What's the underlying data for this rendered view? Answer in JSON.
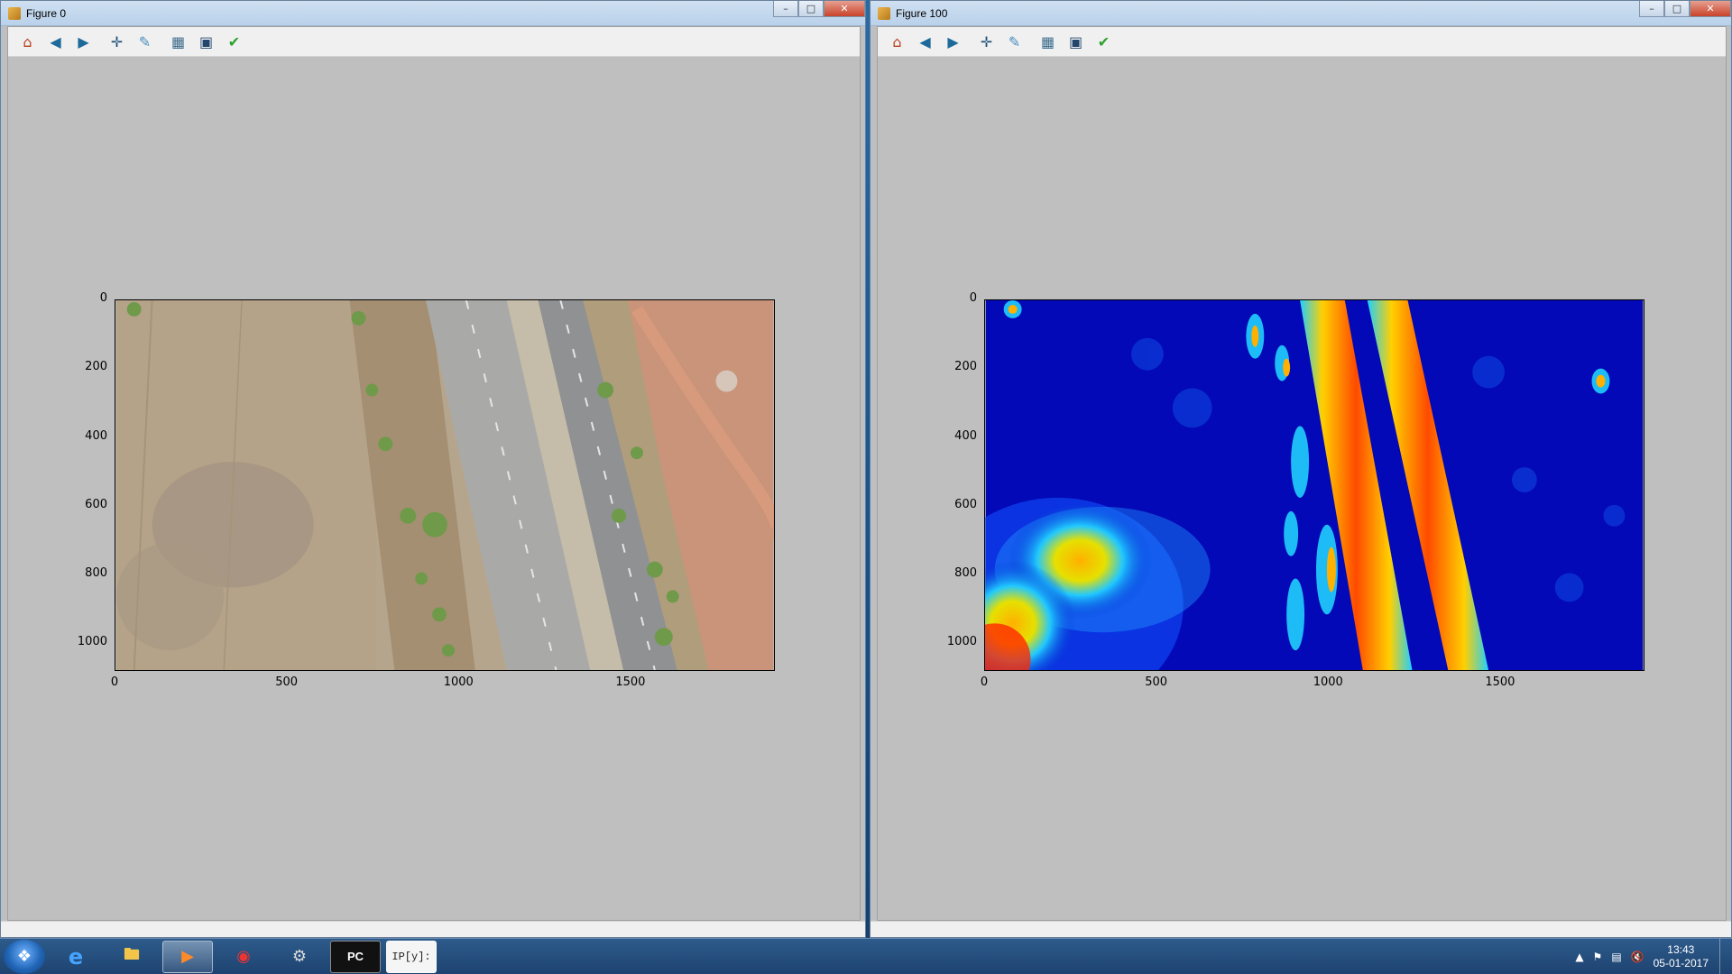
{
  "windows": [
    {
      "title": "Figure 0",
      "toolbar": [
        "home-icon",
        "back-icon",
        "forward-icon",
        "pan-icon",
        "zoom-icon",
        "configure-subplots-icon",
        "save-icon",
        "edit-icon"
      ],
      "axes": {
        "yticks": [
          "0",
          "200",
          "400",
          "600",
          "800",
          "1000"
        ],
        "xticks": [
          "0",
          "500",
          "1000",
          "1500"
        ]
      }
    },
    {
      "title": "Figure 100",
      "toolbar": [
        "home-icon",
        "back-icon",
        "forward-icon",
        "pan-icon",
        "zoom-icon",
        "configure-subplots-icon",
        "save-icon",
        "edit-icon"
      ],
      "axes": {
        "yticks": [
          "0",
          "200",
          "400",
          "600",
          "800",
          "1000"
        ],
        "xticks": [
          "0",
          "500",
          "1000",
          "1500"
        ]
      }
    }
  ],
  "window_controls": {
    "minimize": "–",
    "maximize": "□",
    "close": "✕"
  },
  "taskbar": {
    "apps": [
      "internet-explorer-icon",
      "file-explorer-icon",
      "media-player-icon",
      "chrome-icon",
      "gimp-icon",
      "pycharm-icon",
      "ipython-icon"
    ],
    "pycharm_label": "PC",
    "ipython_label": "IP[y]:",
    "time": "13:43",
    "date": "05-01-2017"
  },
  "colors": {
    "window_bg": "#bfbfbf",
    "toolbar_bg": "#f0f0f0",
    "heatmap_low": "#00008f",
    "heatmap_high": "#ff3000"
  }
}
